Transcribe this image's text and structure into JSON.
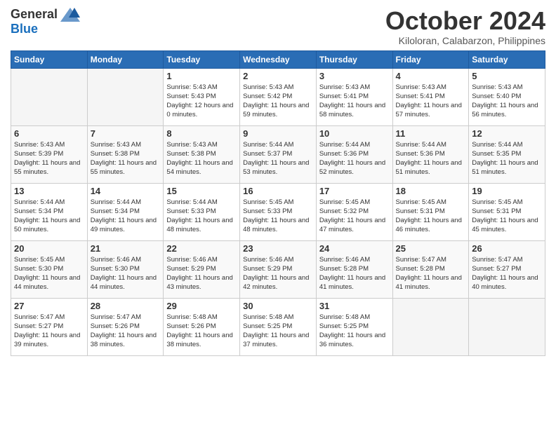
{
  "logo": {
    "general": "General",
    "blue": "Blue"
  },
  "title": {
    "month": "October 2024",
    "location": "Kiloloran, Calabarzon, Philippines"
  },
  "weekdays": [
    "Sunday",
    "Monday",
    "Tuesday",
    "Wednesday",
    "Thursday",
    "Friday",
    "Saturday"
  ],
  "weeks": [
    [
      {
        "day": null
      },
      {
        "day": null
      },
      {
        "day": "1",
        "sunrise": "5:43 AM",
        "sunset": "5:43 PM",
        "daylight": "12 hours and 0 minutes."
      },
      {
        "day": "2",
        "sunrise": "5:43 AM",
        "sunset": "5:42 PM",
        "daylight": "11 hours and 59 minutes."
      },
      {
        "day": "3",
        "sunrise": "5:43 AM",
        "sunset": "5:41 PM",
        "daylight": "11 hours and 58 minutes."
      },
      {
        "day": "4",
        "sunrise": "5:43 AM",
        "sunset": "5:41 PM",
        "daylight": "11 hours and 57 minutes."
      },
      {
        "day": "5",
        "sunrise": "5:43 AM",
        "sunset": "5:40 PM",
        "daylight": "11 hours and 56 minutes."
      }
    ],
    [
      {
        "day": "6",
        "sunrise": "5:43 AM",
        "sunset": "5:39 PM",
        "daylight": "11 hours and 55 minutes."
      },
      {
        "day": "7",
        "sunrise": "5:43 AM",
        "sunset": "5:38 PM",
        "daylight": "11 hours and 55 minutes."
      },
      {
        "day": "8",
        "sunrise": "5:43 AM",
        "sunset": "5:38 PM",
        "daylight": "11 hours and 54 minutes."
      },
      {
        "day": "9",
        "sunrise": "5:44 AM",
        "sunset": "5:37 PM",
        "daylight": "11 hours and 53 minutes."
      },
      {
        "day": "10",
        "sunrise": "5:44 AM",
        "sunset": "5:36 PM",
        "daylight": "11 hours and 52 minutes."
      },
      {
        "day": "11",
        "sunrise": "5:44 AM",
        "sunset": "5:36 PM",
        "daylight": "11 hours and 51 minutes."
      },
      {
        "day": "12",
        "sunrise": "5:44 AM",
        "sunset": "5:35 PM",
        "daylight": "11 hours and 51 minutes."
      }
    ],
    [
      {
        "day": "13",
        "sunrise": "5:44 AM",
        "sunset": "5:34 PM",
        "daylight": "11 hours and 50 minutes."
      },
      {
        "day": "14",
        "sunrise": "5:44 AM",
        "sunset": "5:34 PM",
        "daylight": "11 hours and 49 minutes."
      },
      {
        "day": "15",
        "sunrise": "5:44 AM",
        "sunset": "5:33 PM",
        "daylight": "11 hours and 48 minutes."
      },
      {
        "day": "16",
        "sunrise": "5:45 AM",
        "sunset": "5:33 PM",
        "daylight": "11 hours and 48 minutes."
      },
      {
        "day": "17",
        "sunrise": "5:45 AM",
        "sunset": "5:32 PM",
        "daylight": "11 hours and 47 minutes."
      },
      {
        "day": "18",
        "sunrise": "5:45 AM",
        "sunset": "5:31 PM",
        "daylight": "11 hours and 46 minutes."
      },
      {
        "day": "19",
        "sunrise": "5:45 AM",
        "sunset": "5:31 PM",
        "daylight": "11 hours and 45 minutes."
      }
    ],
    [
      {
        "day": "20",
        "sunrise": "5:45 AM",
        "sunset": "5:30 PM",
        "daylight": "11 hours and 44 minutes."
      },
      {
        "day": "21",
        "sunrise": "5:46 AM",
        "sunset": "5:30 PM",
        "daylight": "11 hours and 44 minutes."
      },
      {
        "day": "22",
        "sunrise": "5:46 AM",
        "sunset": "5:29 PM",
        "daylight": "11 hours and 43 minutes."
      },
      {
        "day": "23",
        "sunrise": "5:46 AM",
        "sunset": "5:29 PM",
        "daylight": "11 hours and 42 minutes."
      },
      {
        "day": "24",
        "sunrise": "5:46 AM",
        "sunset": "5:28 PM",
        "daylight": "11 hours and 41 minutes."
      },
      {
        "day": "25",
        "sunrise": "5:47 AM",
        "sunset": "5:28 PM",
        "daylight": "11 hours and 41 minutes."
      },
      {
        "day": "26",
        "sunrise": "5:47 AM",
        "sunset": "5:27 PM",
        "daylight": "11 hours and 40 minutes."
      }
    ],
    [
      {
        "day": "27",
        "sunrise": "5:47 AM",
        "sunset": "5:27 PM",
        "daylight": "11 hours and 39 minutes."
      },
      {
        "day": "28",
        "sunrise": "5:47 AM",
        "sunset": "5:26 PM",
        "daylight": "11 hours and 38 minutes."
      },
      {
        "day": "29",
        "sunrise": "5:48 AM",
        "sunset": "5:26 PM",
        "daylight": "11 hours and 38 minutes."
      },
      {
        "day": "30",
        "sunrise": "5:48 AM",
        "sunset": "5:25 PM",
        "daylight": "11 hours and 37 minutes."
      },
      {
        "day": "31",
        "sunrise": "5:48 AM",
        "sunset": "5:25 PM",
        "daylight": "11 hours and 36 minutes."
      },
      {
        "day": null
      },
      {
        "day": null
      }
    ]
  ]
}
